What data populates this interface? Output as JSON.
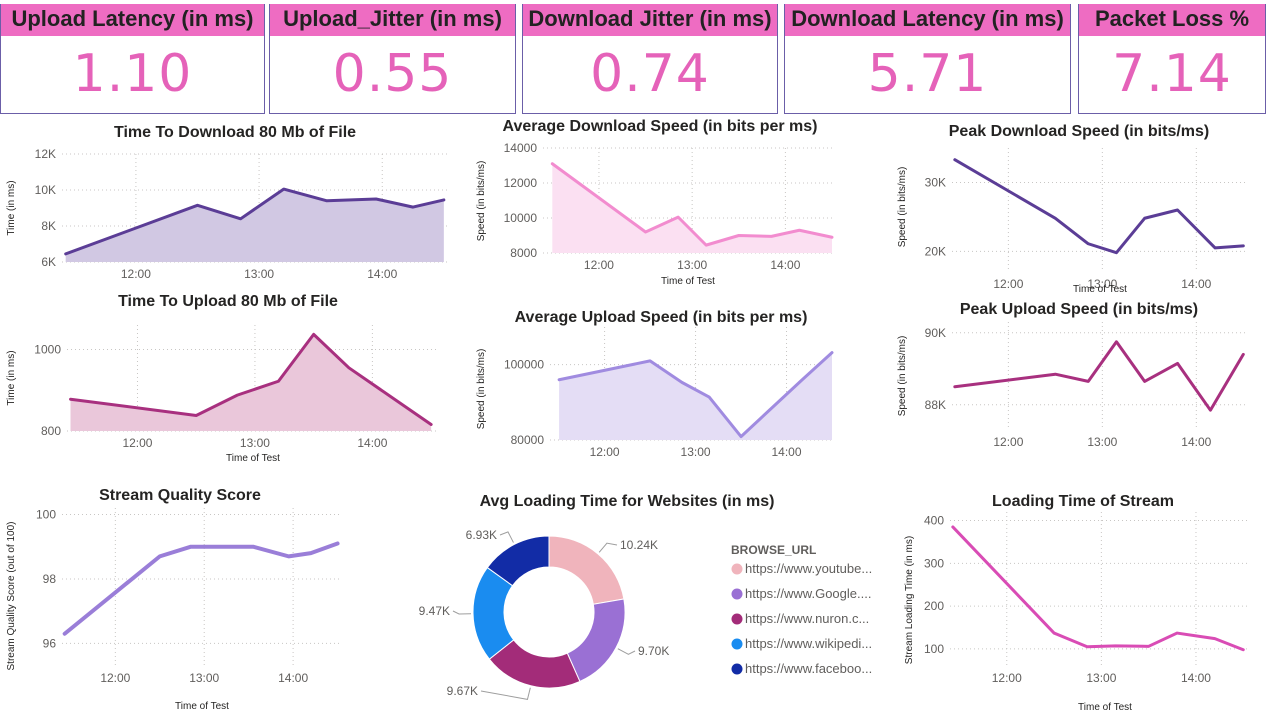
{
  "kpis": [
    {
      "label": "Upload Latency (in ms)",
      "value": "1.10"
    },
    {
      "label": "Upload_Jitter (in ms)",
      "value": "0.55"
    },
    {
      "label": "Download Jitter (in ms)",
      "value": "0.74"
    },
    {
      "label": "Download Latency (in ms)",
      "value": "5.71"
    },
    {
      "label": "Packet Loss %",
      "value": "7.14"
    }
  ],
  "colors": {
    "kpi_header": "#ee6cc2",
    "kpi_value": "#e562b9",
    "kpi_border": "#6b5ea8"
  },
  "chart_data": [
    {
      "id": "dl_time",
      "type": "area",
      "title": "Time To Download 80 Mb of File",
      "xlabel": "",
      "ylabel": "Time (in ms)",
      "ylim": [
        6000,
        12000
      ],
      "yticks": [
        6000,
        8000,
        10000,
        12000
      ],
      "ytick_labels": [
        "6K",
        "8K",
        "10K",
        "12K"
      ],
      "xlim": [
        11.4,
        14.55
      ],
      "xticks": [
        12,
        13,
        14
      ],
      "xtick_labels": [
        "12:00",
        "13:00",
        "14:00"
      ],
      "color": "#5b3d96",
      "fill": "#d1c8e3",
      "x": [
        11.43,
        12.5,
        12.85,
        13.2,
        13.55,
        13.95,
        14.25,
        14.5
      ],
      "y": [
        6450,
        9150,
        8400,
        10050,
        9400,
        9500,
        9050,
        9450
      ]
    },
    {
      "id": "ul_time",
      "type": "area",
      "title": "Time To Upload 80 Mb of File",
      "xlabel": "Time of Test",
      "ylabel": "Time (in ms)",
      "ylim": [
        800,
        1060
      ],
      "yticks": [
        800,
        1000
      ],
      "ytick_labels": [
        "800",
        "1000"
      ],
      "xlim": [
        11.4,
        14.55
      ],
      "xticks": [
        12,
        13,
        14
      ],
      "xtick_labels": [
        "12:00",
        "13:00",
        "14:00"
      ],
      "color": "#a8307f",
      "fill": "#eac7da",
      "x": [
        11.43,
        12.5,
        12.85,
        13.2,
        13.5,
        13.8,
        14.5
      ],
      "y": [
        878,
        838,
        888,
        922,
        1037,
        955,
        816
      ]
    },
    {
      "id": "avg_dl",
      "type": "area",
      "title": "Average Download Speed (in bits per ms)",
      "xlabel": "Time of Test",
      "ylabel": "Speed (in bits/ms)",
      "ylim": [
        8000,
        14000
      ],
      "yticks": [
        8000,
        10000,
        12000,
        14000
      ],
      "ytick_labels": [
        "8000",
        "10000",
        "12000",
        "14000"
      ],
      "xlim": [
        11.4,
        14.5
      ],
      "xticks": [
        12,
        13,
        14
      ],
      "xtick_labels": [
        "12:00",
        "13:00",
        "14:00"
      ],
      "color": "#f28ccf",
      "fill": "#fbe0f2",
      "x": [
        11.5,
        12.5,
        12.85,
        13.15,
        13.5,
        13.85,
        14.15,
        14.5
      ],
      "y": [
        13100,
        9200,
        10050,
        8450,
        9000,
        8950,
        9300,
        8900
      ]
    },
    {
      "id": "avg_ul",
      "type": "area",
      "title": "Average Upload Speed (in bits per ms)",
      "xlabel": "",
      "ylabel": "Speed (in bits/ms)",
      "ylim": [
        80000,
        110000
      ],
      "yticks": [
        80000,
        100000
      ],
      "ytick_labels": [
        "80000",
        "100000"
      ],
      "xlim": [
        11.4,
        14.5
      ],
      "xticks": [
        12,
        13,
        14
      ],
      "xtick_labels": [
        "12:00",
        "13:00",
        "14:00"
      ],
      "color": "#a08be0",
      "fill": "#e4ddf5",
      "x": [
        11.5,
        12.5,
        12.85,
        13.15,
        13.5,
        14.15,
        14.5
      ],
      "y": [
        96000,
        101000,
        95300,
        91400,
        80900,
        95500,
        103200
      ]
    },
    {
      "id": "peak_dl",
      "type": "line",
      "title": "Peak Download Speed (in bits/ms)",
      "xlabel": "Time of Test",
      "ylabel": "Speed (in bits/ms)",
      "ylim": [
        17000,
        35000
      ],
      "yticks": [
        20000,
        30000
      ],
      "ytick_labels": [
        "20K",
        "30K"
      ],
      "xlim": [
        11.4,
        14.55
      ],
      "xticks": [
        12,
        13,
        14
      ],
      "xtick_labels": [
        "12:00",
        "13:00",
        "14:00"
      ],
      "color": "#5b3d96",
      "x": [
        11.43,
        12.5,
        12.85,
        13.15,
        13.45,
        13.8,
        14.2,
        14.5
      ],
      "y": [
        33300,
        24800,
        21100,
        19800,
        24800,
        26000,
        20500,
        20800
      ]
    },
    {
      "id": "peak_ul",
      "type": "line",
      "title": "Peak Upload Speed (in bits/ms)",
      "xlabel": "",
      "ylabel": "Speed (in bits/ms)",
      "ylim": [
        87300,
        90300
      ],
      "yticks": [
        88000,
        90000
      ],
      "ytick_labels": [
        "88K",
        "90K"
      ],
      "xlim": [
        11.4,
        14.55
      ],
      "xticks": [
        12,
        13,
        14
      ],
      "xtick_labels": [
        "12:00",
        "13:00",
        "14:00"
      ],
      "color": "#a8307f",
      "x": [
        11.43,
        12.5,
        12.85,
        13.15,
        13.45,
        13.8,
        14.15,
        14.5
      ],
      "y": [
        88500,
        88850,
        88650,
        89750,
        88650,
        89150,
        87850,
        89400
      ]
    },
    {
      "id": "stream_q",
      "type": "line",
      "title": "Stream Quality Score",
      "xlabel": "Time of Test",
      "ylabel": "Stream Quality Score (out of 100)",
      "ylim": [
        95.3,
        100.2
      ],
      "yticks": [
        96,
        98,
        100
      ],
      "ytick_labels": [
        "96",
        "98",
        "100"
      ],
      "xlim": [
        11.4,
        14.55
      ],
      "xticks": [
        12,
        13,
        14
      ],
      "xtick_labels": [
        "12:00",
        "13:00",
        "14:00"
      ],
      "color": "#9a7ed8",
      "x": [
        11.43,
        12.5,
        12.85,
        13.2,
        13.55,
        13.95,
        14.2,
        14.5
      ],
      "y": [
        96.3,
        98.7,
        99.0,
        99.0,
        99.0,
        98.7,
        98.8,
        99.1
      ]
    },
    {
      "id": "stream_lt",
      "type": "line",
      "title": "Loading Time of Stream",
      "xlabel": "Time of Test",
      "ylabel": "Stream Loading Time (in ms)",
      "ylim": [
        60,
        420
      ],
      "yticks": [
        100,
        200,
        300,
        400
      ],
      "ytick_labels": [
        "100",
        "200",
        "300",
        "400"
      ],
      "xlim": [
        11.4,
        14.55
      ],
      "xticks": [
        12,
        13,
        14
      ],
      "xtick_labels": [
        "12:00",
        "13:00",
        "14:00"
      ],
      "color": "#d94cb5",
      "x": [
        11.43,
        12.5,
        12.85,
        13.15,
        13.5,
        13.8,
        14.2,
        14.5
      ],
      "y": [
        385,
        137,
        105,
        107,
        106,
        137,
        124,
        98
      ]
    },
    {
      "id": "websites",
      "type": "pie",
      "title": "Avg Loading Time for Websites (in ms)",
      "legend_title": "BROWSE_URL",
      "labels": [
        "https://www.youtube...",
        "https://www.Google....",
        "https://www.nuron.c...",
        "https://www.wikipedi...",
        "https://www.faceboo..."
      ],
      "values": [
        10240,
        9700,
        9670,
        9470,
        6930
      ],
      "data_labels": [
        "10.24K",
        "9.70K",
        "9.67K",
        "9.47K",
        "6.93K"
      ],
      "colors": [
        "#f0b4bc",
        "#9a70d4",
        "#a32c79",
        "#1a8cf0",
        "#122ca6"
      ]
    }
  ]
}
